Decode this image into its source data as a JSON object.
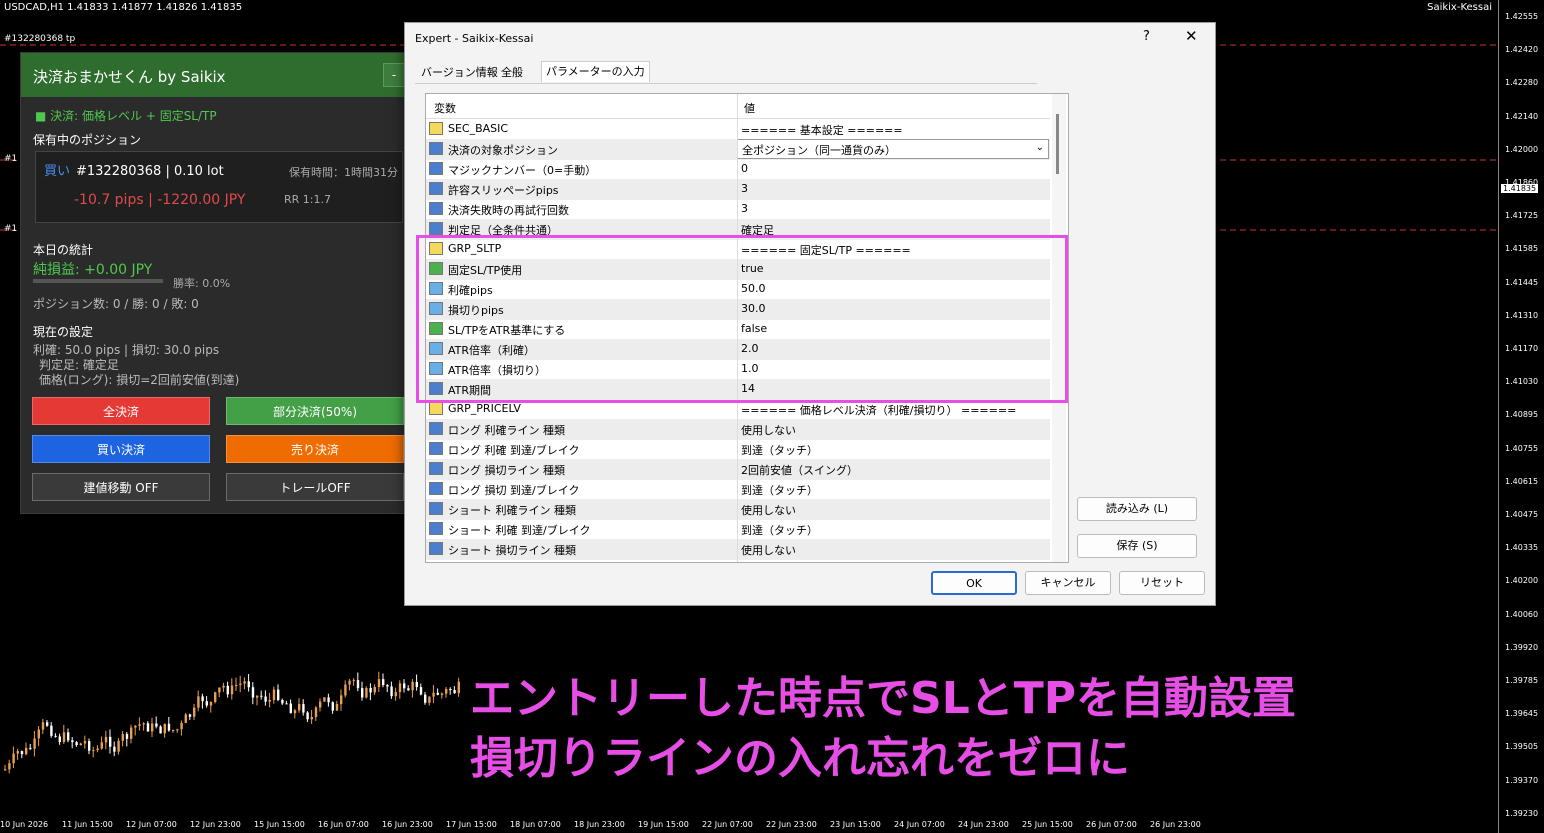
{
  "chart": {
    "symbol_header": "USDCAD,H1  1.41833 1.41877 1.41826 1.41835",
    "ea_name": "Saikix-Kessai",
    "order_labels": [
      "#132280368 tp",
      "#1",
      "#1"
    ],
    "price_ticks": [
      "1.42555",
      "1.42420",
      "1.42280",
      "1.42140",
      "1.42000",
      "1.41860",
      "1.41725",
      "1.41585",
      "1.41445",
      "1.41310",
      "1.41170",
      "1.41030",
      "1.40895",
      "1.40755",
      "1.40615",
      "1.40475",
      "1.40335",
      "1.40200",
      "1.40060",
      "1.39920",
      "1.39785",
      "1.39645",
      "1.39505",
      "1.39370",
      "1.39230"
    ],
    "current_price": "1.41835",
    "time_ticks": [
      "10 Jun 2026",
      "11 Jun 15:00",
      "12 Jun 07:00",
      "12 Jun 23:00",
      "15 Jun 15:00",
      "16 Jun 07:00",
      "16 Jun 23:00",
      "17 Jun 15:00",
      "18 Jun 07:00",
      "18 Jun 23:00",
      "19 Jun 15:00",
      "22 Jun 07:00",
      "22 Jun 23:00",
      "23 Jun 15:00",
      "24 Jun 07:00",
      "24 Jun 23:00",
      "25 Jun 15:00",
      "26 Jun 07:00",
      "26 Jun 23:00"
    ]
  },
  "panel": {
    "title": "決済おまかせくん by Saikix",
    "minimize": "-",
    "mode": "■ 決済: 価格レベル + 固定SL/TP",
    "positions_header": "保有中のポジション",
    "side": "買い",
    "ticket_lot": "#132280368 | 0.10 lot",
    "hold_time": "保有時間：1時間31分",
    "pl": "-10.7 pips | -1220.00 JPY",
    "rr": "RR 1:1.7",
    "stats_header": "本日の統計",
    "net": "純損益: +0.00 JPY",
    "winrate": "勝率: 0.0%",
    "counts": "ポジション数: 0 / 勝: 0 / 敗: 0",
    "settings_header": "現在の設定",
    "setting1": "利確: 50.0 pips | 損切: 30.0 pips",
    "setting2": "判定足: 確定足",
    "setting3": "価格(ロング): 損切=2回前安値(到達)",
    "buttons": {
      "close_all": "全決済",
      "partial": "部分決済(50%)",
      "close_buy": "買い決済",
      "close_sell": "売り決済",
      "breakeven": "建値移動 OFF",
      "trail": "トレールOFF"
    },
    "colors": {
      "close_all": "#e53935",
      "partial": "#43a047",
      "close_buy": "#1e63e0",
      "close_sell": "#ef6c00",
      "breakeven": "#3a3a3a",
      "trail": "#3a3a3a"
    }
  },
  "dialog": {
    "title": "Expert - Saikix-Kessai",
    "help": "?",
    "close": "✕",
    "tabs": [
      "バージョン情報",
      "全般",
      "パラメーターの入力"
    ],
    "col_var": "変数",
    "col_val": "値",
    "rows": [
      {
        "icon": "ab",
        "name": "SEC_BASIC",
        "value": "====== 基本設定 ======"
      },
      {
        "icon": "123",
        "name": "決済の対象ポジション",
        "value": "全ポジション（同一通貨のみ）",
        "select": true
      },
      {
        "icon": "123",
        "name": "マジックナンバー（0=手動）",
        "value": "0"
      },
      {
        "icon": "123",
        "name": "許容スリッページpips",
        "value": "3"
      },
      {
        "icon": "123",
        "name": "決済失敗時の再試行回数",
        "value": "3"
      },
      {
        "icon": "123",
        "name": "判定足（全条件共通）",
        "value": "確定足"
      },
      {
        "icon": "ab",
        "name": "GRP_SLTP",
        "value": "====== 固定SL/TP ======"
      },
      {
        "icon": "bool",
        "name": "固定SL/TP使用",
        "value": "true"
      },
      {
        "icon": "½",
        "name": "利確pips",
        "value": "50.0"
      },
      {
        "icon": "½",
        "name": "損切りpips",
        "value": "30.0"
      },
      {
        "icon": "bool",
        "name": "SL/TPをATR基準にする",
        "value": "false"
      },
      {
        "icon": "½",
        "name": "ATR倍率（利確）",
        "value": "2.0"
      },
      {
        "icon": "½",
        "name": "ATR倍率（損切り）",
        "value": "1.0"
      },
      {
        "icon": "123",
        "name": "ATR期間",
        "value": "14"
      },
      {
        "icon": "ab",
        "name": "GRP_PRICELV",
        "value": "====== 価格レベル決済（利確/損切り） ======"
      },
      {
        "icon": "123",
        "name": "ロング 利確ライン 種類",
        "value": "使用しない"
      },
      {
        "icon": "123",
        "name": "ロング 利確 到達/ブレイク",
        "value": "到達（タッチ）"
      },
      {
        "icon": "123",
        "name": "ロング 損切ライン 種類",
        "value": "2回前安値（スイング）"
      },
      {
        "icon": "123",
        "name": "ロング 損切 到達/ブレイク",
        "value": "到達（タッチ）"
      },
      {
        "icon": "123",
        "name": "ショート 利確ライン 種類",
        "value": "使用しない"
      },
      {
        "icon": "123",
        "name": "ショート 利確 到達/ブレイク",
        "value": "到達（タッチ）"
      },
      {
        "icon": "123",
        "name": "ショート 損切ライン 種類",
        "value": "使用しない"
      }
    ],
    "load": "読み込み (L)",
    "save": "保存 (S)",
    "ok": "OK",
    "cancel": "キャンセル",
    "reset": "リセット"
  },
  "caption": {
    "line1": "エントリーした時点でSLとTPを自動設置",
    "line2": "損切りラインの入れ忘れをゼロに",
    "color": "#e64ee6"
  }
}
